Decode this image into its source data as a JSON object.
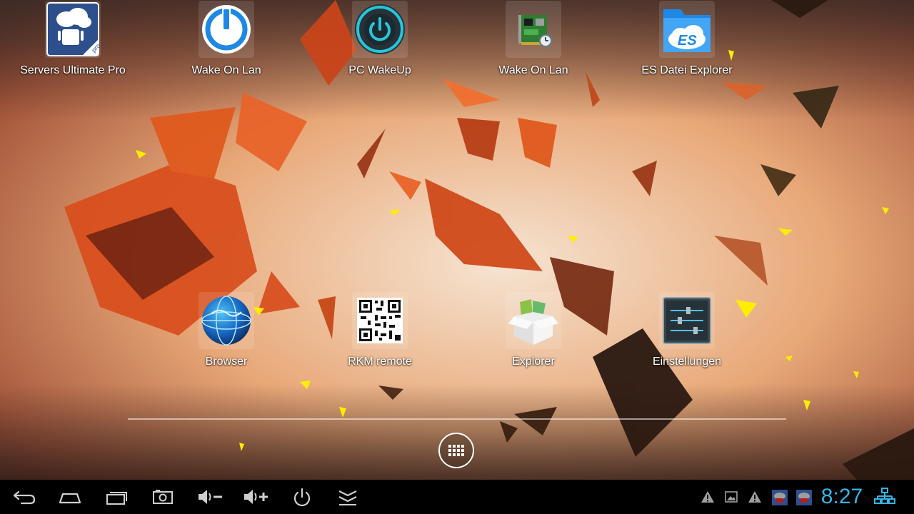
{
  "home": {
    "row1": [
      {
        "label": "Servers Ultimate Pro",
        "icon": "servers-ultimate-pro-icon"
      },
      {
        "label": "Wake On Lan",
        "icon": "wake-on-lan-power-icon"
      },
      {
        "label": "PC WakeUp",
        "icon": "pc-wakeup-power-icon"
      },
      {
        "label": "Wake On Lan",
        "icon": "network-card-icon"
      },
      {
        "label": "ES Datei Explorer",
        "icon": "es-file-explorer-icon"
      }
    ],
    "row2": [
      {
        "label": "Browser",
        "icon": "globe-icon"
      },
      {
        "label": "RKM remote",
        "icon": "qr-code-icon"
      },
      {
        "label": "Explorer",
        "icon": "explorer-box-icon"
      },
      {
        "label": "Einstellungen",
        "icon": "settings-sliders-icon"
      }
    ]
  },
  "dock": {
    "drawer_icon": "app-drawer-icon"
  },
  "navbar": {
    "buttons": [
      "back-icon",
      "home-icon",
      "recent-apps-icon",
      "screenshot-icon",
      "volume-down-icon",
      "volume-up-icon",
      "power-icon",
      "collapse-icon"
    ],
    "status_icons": [
      "warning-icon",
      "image-icon",
      "warning-icon",
      "cloud-upload-icon",
      "cloud-upload-icon",
      "ethernet-icon"
    ],
    "clock": "8:27"
  },
  "colors": {
    "accent": "#33b5e5",
    "navbar": "#000000"
  }
}
